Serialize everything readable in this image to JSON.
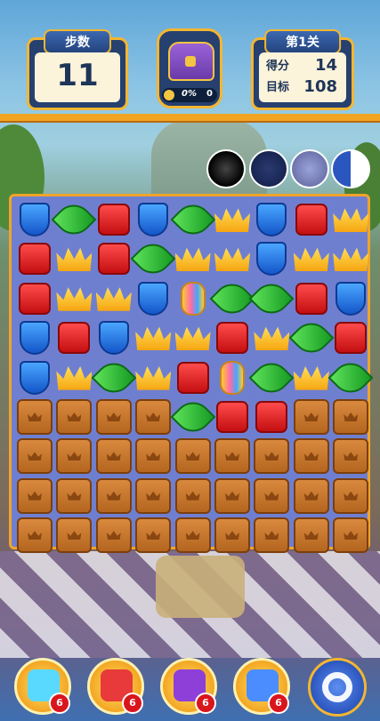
{
  "hud": {
    "moves_label": "步数",
    "moves_value": "11",
    "level_label": "第1关",
    "score_label": "得分",
    "score_value": "14",
    "target_label": "目标",
    "target_value": "108",
    "chest_progress": "0%",
    "chest_count": "0"
  },
  "board": {
    "rows": [
      [
        "shield",
        "leaf",
        "cube",
        "shield",
        "leaf",
        "crown",
        "shield",
        "cube",
        "crown"
      ],
      [
        "cube",
        "crown",
        "cube",
        "leaf",
        "crown",
        "crown",
        "shield",
        "crown",
        "crown"
      ],
      [
        "cube",
        "crown",
        "crown",
        "shield",
        "bomb",
        "leaf",
        "leaf",
        "cube",
        "shield"
      ],
      [
        "shield",
        "cube",
        "shield",
        "crown",
        "crown",
        "cube",
        "crown",
        "leaf",
        "cube"
      ],
      [
        "shield",
        "crown",
        "leaf",
        "crown",
        "cube",
        "bomb",
        "leaf",
        "crown",
        "leaf"
      ],
      [
        "crate",
        "crate",
        "crate",
        "crate",
        "leaf",
        "cube",
        "cube",
        "crate",
        "crate"
      ],
      [
        "crate",
        "crate",
        "crate",
        "crate",
        "crate",
        "crate",
        "crate",
        "crate",
        "crate"
      ],
      [
        "crate",
        "crate",
        "crate",
        "crate",
        "crate",
        "crate",
        "crate",
        "crate",
        "crate"
      ],
      [
        "crate",
        "crate",
        "crate",
        "crate",
        "crate",
        "crate",
        "crate",
        "crate",
        "crate"
      ]
    ]
  },
  "boosters": [
    {
      "name": "cannon",
      "count": "6"
    },
    {
      "name": "crossbow",
      "count": "6"
    },
    {
      "name": "jester-hat",
      "count": "6"
    },
    {
      "name": "hammer",
      "count": "6"
    }
  ],
  "colors": {
    "board_bg": "#6f7fd0",
    "hud_border": "#f3b631",
    "hud_navy": "#26406f"
  }
}
